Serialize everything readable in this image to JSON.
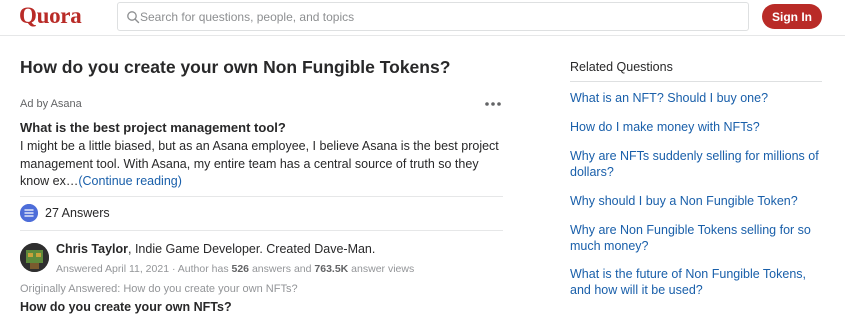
{
  "header": {
    "logo_text": "Quora",
    "search_placeholder": "Search for questions, people, and topics",
    "signin_label": "Sign In"
  },
  "question": {
    "title": "How do you create your own Non Fungible Tokens?"
  },
  "ad": {
    "label": "Ad by Asana",
    "title": "What is the best project management tool?",
    "body": "I might be a little biased, but as an Asana employee, I believe Asana is the best project management tool. With Asana, my entire team has a central source of truth so they know ex…",
    "continue_label": "(Continue reading)"
  },
  "answers": {
    "count_label": "27 Answers"
  },
  "answer": {
    "author_name": "Chris Taylor",
    "author_credential": ", Indie Game Developer. Created Dave-Man.",
    "meta_prefix": "Answered April 11, 2021 · Author has ",
    "answers_count": "526",
    "meta_middle": " answers and ",
    "views_count": "763.5K",
    "meta_suffix": " answer views",
    "originally_answered": "Originally Answered: How do you create your own NFTs?",
    "original_question": "How do you create your own NFTs?"
  },
  "related": {
    "heading": "Related Questions",
    "items": [
      "What is an NFT? Should I buy one?",
      "How do I make money with NFTs?",
      "Why are NFTs suddenly selling for millions of dollars?",
      "Why should I buy a Non Fungible Token?",
      "Why are Non Fungible Tokens selling for so much money?",
      "What is the future of Non Fungible Tokens, and how will it be used?"
    ]
  },
  "colors": {
    "brand": "#b92b27",
    "link": "#195faa",
    "text": "#282829",
    "muted": "#939598"
  },
  "icons": {
    "search": "search-icon",
    "more": "more-options-icon",
    "answers": "answers-icon"
  }
}
